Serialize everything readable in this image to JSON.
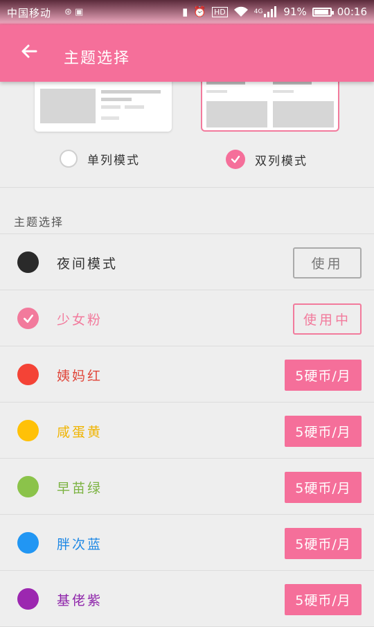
{
  "status_bar": {
    "carrier": "中国移动",
    "network": "4G",
    "battery_percent": "91%",
    "battery_level": 0.91,
    "time": "00:16",
    "icons": [
      "vibrate-icon",
      "alarm-icon",
      "hd-icon",
      "wifi-icon",
      "signal-icon",
      "battery-icon"
    ]
  },
  "app_bar": {
    "title": "主题选择",
    "back_icon": "arrow-left-icon"
  },
  "layout_modes": [
    {
      "label": "单列模式",
      "selected": false
    },
    {
      "label": "双列模式",
      "selected": true
    }
  ],
  "section_title": "主题选择",
  "themes": [
    {
      "name": "夜间模式",
      "color": "#2a2a2a",
      "name_color": "#333333",
      "action": "使用",
      "action_style": "outline",
      "selected": false
    },
    {
      "name": "少女粉",
      "color": "#f27a9c",
      "name_color": "#f27a9c",
      "action": "使用中",
      "action_style": "outline-active",
      "selected": true
    },
    {
      "name": "姨妈红",
      "color": "#f44336",
      "name_color": "#e0463a",
      "action": "5硬币/月",
      "action_style": "fill",
      "selected": false
    },
    {
      "name": "咸蛋黄",
      "color": "#ffc107",
      "name_color": "#f0b400",
      "action": "5硬币/月",
      "action_style": "fill",
      "selected": false
    },
    {
      "name": "早苗绿",
      "color": "#8bc34a",
      "name_color": "#7cb342",
      "action": "5硬币/月",
      "action_style": "fill",
      "selected": false
    },
    {
      "name": "胖次蓝",
      "color": "#2196f3",
      "name_color": "#1e88e5",
      "action": "5硬币/月",
      "action_style": "fill",
      "selected": false
    },
    {
      "name": "基佬紫",
      "color": "#9c27b0",
      "name_color": "#8e24aa",
      "action": "5硬币/月",
      "action_style": "fill",
      "selected": false
    }
  ],
  "colors": {
    "accent": "#f56f9a",
    "background": "#eeeeee"
  }
}
